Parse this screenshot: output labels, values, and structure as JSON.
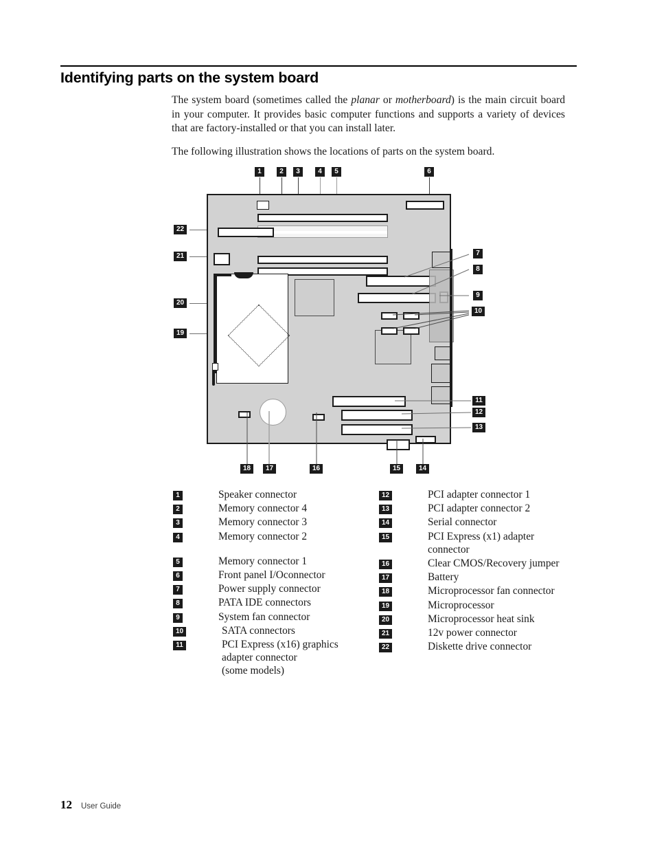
{
  "page": {
    "title": "Identifying parts on the system board",
    "paragraph1_parts": {
      "a": "The system board (sometimes called the ",
      "italic1": "planar",
      "b": " or ",
      "italic2": "motherboard",
      "c": ") is the main circuit board in your computer. It provides basic computer functions and supports a variety of devices that are factory-installed or that you can install later."
    },
    "paragraph2": "The following illustration shows the locations of parts on the system board.",
    "footer": {
      "page_number": "12",
      "label": "User Guide"
    }
  },
  "diagram": {
    "name": "system-board-illustration",
    "callouts": [
      "1",
      "2",
      "3",
      "4",
      "5",
      "6",
      "7",
      "8",
      "9",
      "10",
      "11",
      "12",
      "13",
      "14",
      "15",
      "16",
      "17",
      "18",
      "19",
      "20",
      "21",
      "22"
    ]
  },
  "legend": {
    "left": [
      {
        "num": "1",
        "text": "Speaker connector"
      },
      {
        "num": "2",
        "text": "Memory connector 4"
      },
      {
        "num": "3",
        "text": "Memory connector 3"
      },
      {
        "num": "4",
        "text": "Memory connector 2"
      },
      {
        "num": "5",
        "text": "Memory connector 1"
      },
      {
        "num": "6",
        "text": "Front panel I/Oconnector"
      },
      {
        "num": "7",
        "text": "Power supply connector"
      },
      {
        "num": "8",
        "text": "PATA IDE connectors"
      },
      {
        "num": "9",
        "text": "System fan connector"
      },
      {
        "num": "10",
        "text": "SATA connectors"
      },
      {
        "num": "11",
        "text": "PCI Express (x16) graphics\nadapter connector\n(some models)"
      }
    ],
    "right": [
      {
        "num": "12",
        "text": "PCI adapter connector 1"
      },
      {
        "num": "13",
        "text": "PCI adapter connector 2"
      },
      {
        "num": "14",
        "text": "Serial connector"
      },
      {
        "num": "15",
        "text": "PCI Express (x1) adapter\nconnector"
      },
      {
        "num": "16",
        "text": "Clear CMOS/Recovery jumper"
      },
      {
        "num": "17",
        "text": "Battery"
      },
      {
        "num": "18",
        "text": "Microprocessor fan connector"
      },
      {
        "num": "19",
        "text": "Microprocessor"
      },
      {
        "num": "20",
        "text": "Microprocessor heat sink"
      },
      {
        "num": "21",
        "text": "12v power connector"
      },
      {
        "num": "22",
        "text": "Diskette drive connector"
      }
    ]
  },
  "colors": {
    "board_fill": "#d2d2d2",
    "board_outline": "#1b1b1b",
    "badge_bg": "#1b1b1b",
    "badge_fg": "#ffffff",
    "slot_fill": "#ffffff",
    "leader_line": "#6f6f6f"
  }
}
